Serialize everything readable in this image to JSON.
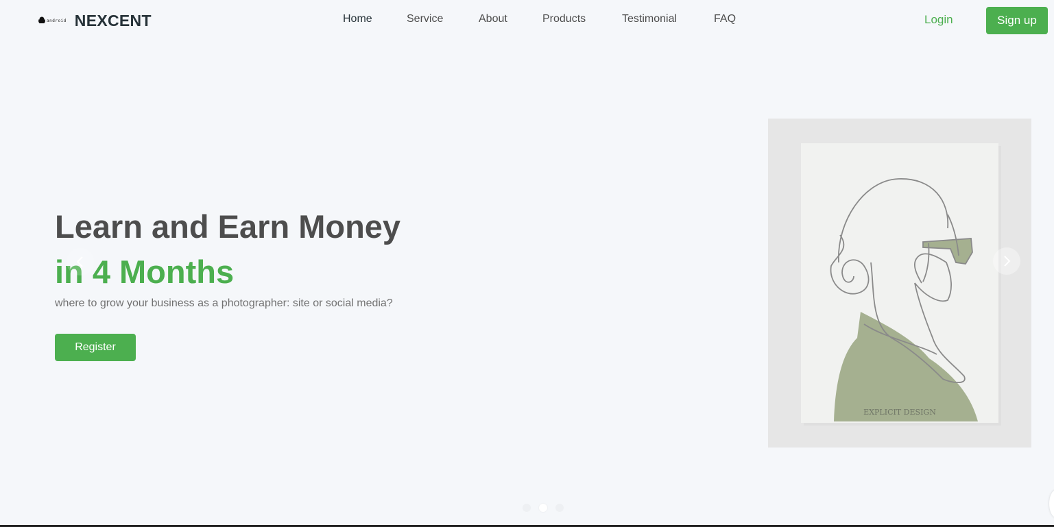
{
  "brand": {
    "name": "NEXCENT",
    "mark_text": "android"
  },
  "nav": {
    "links": [
      {
        "label": "Home",
        "active": true
      },
      {
        "label": "Service",
        "active": false
      },
      {
        "label": "About",
        "active": false
      },
      {
        "label": "Products",
        "active": false
      },
      {
        "label": "Testimonial",
        "active": false
      },
      {
        "label": "FAQ",
        "active": false
      }
    ],
    "login_label": "Login",
    "signup_label": "Sign up"
  },
  "hero": {
    "title": "Learn and Earn Money",
    "highlight": "in 4 Months",
    "subtitle": "where to grow your business as a photographer: site or social media?",
    "cta_label": "Register",
    "poster_caption": "EXPLICIT DESIGN"
  },
  "carousel": {
    "slide_count": 3,
    "active_index": 1
  },
  "colors": {
    "accent": "#4caf4f",
    "background": "#f5f7fa",
    "heading": "#4d4d4d",
    "dark": "#263238",
    "sage": "#a5b090"
  },
  "icons": [
    "android-icon",
    "chevron-left-icon",
    "chevron-right-icon"
  ]
}
